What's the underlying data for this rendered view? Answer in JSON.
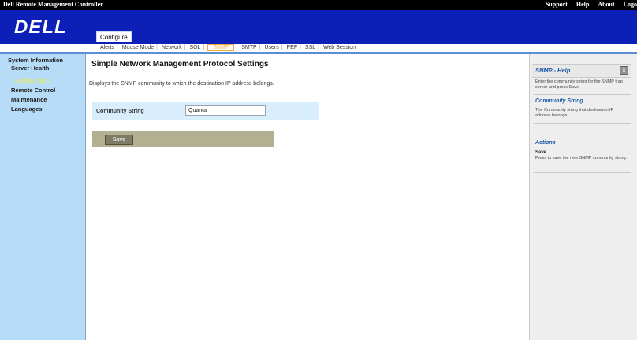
{
  "header": {
    "app_title": "Dell Remote Management Controller",
    "links": [
      "Support",
      "Help",
      "About",
      "Logo"
    ],
    "logo": "DELL",
    "section_tab": "Configure"
  },
  "tabs": [
    "Alerts",
    "Mouse Mode",
    "Network",
    "SOL",
    "SNMP",
    "SMTP",
    "Users",
    "PEF",
    "SSL",
    "Web Session"
  ],
  "active_tab": "SNMP",
  "sidebar": {
    "items": [
      "System Information",
      "Server Health",
      "Configuration",
      "Remote Control",
      "Maintenance",
      "Languages"
    ]
  },
  "main": {
    "title": "Simple Network Management Protocol Settings",
    "description": "Displays the SNMP community to which the destination IP address belongs.",
    "community_label": "Community String",
    "community_value": "Quanta",
    "save_label": "Save"
  },
  "help": {
    "title": "SNMP - Help",
    "intro": "Enter the community string for the SNMP trap server and press Save.",
    "section1_title": "Community String",
    "section1_text": "The Community string that destination IP address belongs",
    "section2_title": "Actions",
    "action_name": "Save",
    "action_text": "Press to save the new SNMP community string."
  },
  "colors": {
    "banner": "#0c1fb6",
    "sidebar": "#b7dcf7",
    "active_highlight": "#f1ed44",
    "help_heading": "#1a57a8"
  }
}
